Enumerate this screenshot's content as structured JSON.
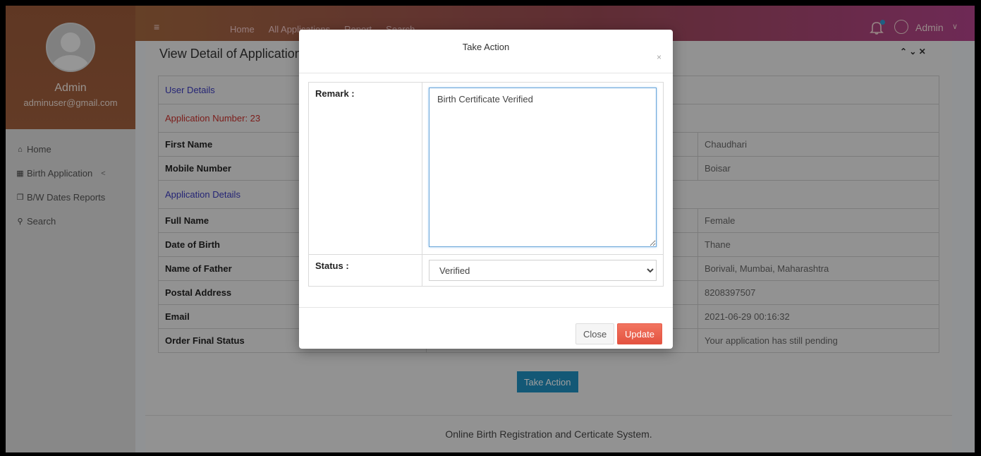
{
  "sidebar": {
    "user_name": "Admin",
    "user_email": "adminuser@gmail.com",
    "items": [
      {
        "label": "Home",
        "icon": "home-icon"
      },
      {
        "label": "Birth Application",
        "icon": "table-icon"
      },
      {
        "label": "B/W Dates Reports",
        "icon": "copy-icon"
      },
      {
        "label": "Search",
        "icon": "search-icon"
      }
    ],
    "submenu_indicator": "<"
  },
  "topbar": {
    "menu_icon": "≡",
    "nav": [
      "Home",
      "All Applications",
      "Report",
      "Search"
    ],
    "user_label": "Admin",
    "caret": "∨"
  },
  "page": {
    "heading": "View Detail of Application",
    "breadcrumb": "⌃ ⌄ ✕"
  },
  "details": {
    "user_section": "User Details",
    "application_number_label": "Application Number: 23",
    "app_section": "Application Details",
    "rows": [
      {
        "label": "First Name",
        "right": "Chaudhari"
      },
      {
        "label": "Mobile Number",
        "right": "Boisar"
      },
      {
        "label": "Full Name",
        "right": "Female"
      },
      {
        "label": "Date of Birth",
        "right": "Thane"
      },
      {
        "label": "Name of Father",
        "right": "Borivali, Mumbai, Maharashtra"
      },
      {
        "label": "Postal Address",
        "right": "8208397507"
      },
      {
        "label": "Email",
        "right": "2021-06-29 00:16:32"
      },
      {
        "label": "Order Final Status",
        "right": "Your application has still pending"
      }
    ]
  },
  "take_action_button": "Take Action",
  "footer": "Online Birth Registration and Certicate System.",
  "modal": {
    "title": "Take Action",
    "close_x": "×",
    "remark_label": "Remark :",
    "remark_value": "Birth Certificate Verified",
    "status_label": "Status :",
    "status_value": "Verified",
    "close_button": "Close",
    "update_button": "Update"
  },
  "colors": {
    "topbar_start": "#a4683f",
    "topbar_end": "#b2438a",
    "section_blue": "#3b3bbd",
    "app_number_red": "#c8312d",
    "primary_button": "#1f8fbf",
    "update_button": "#e35240"
  }
}
